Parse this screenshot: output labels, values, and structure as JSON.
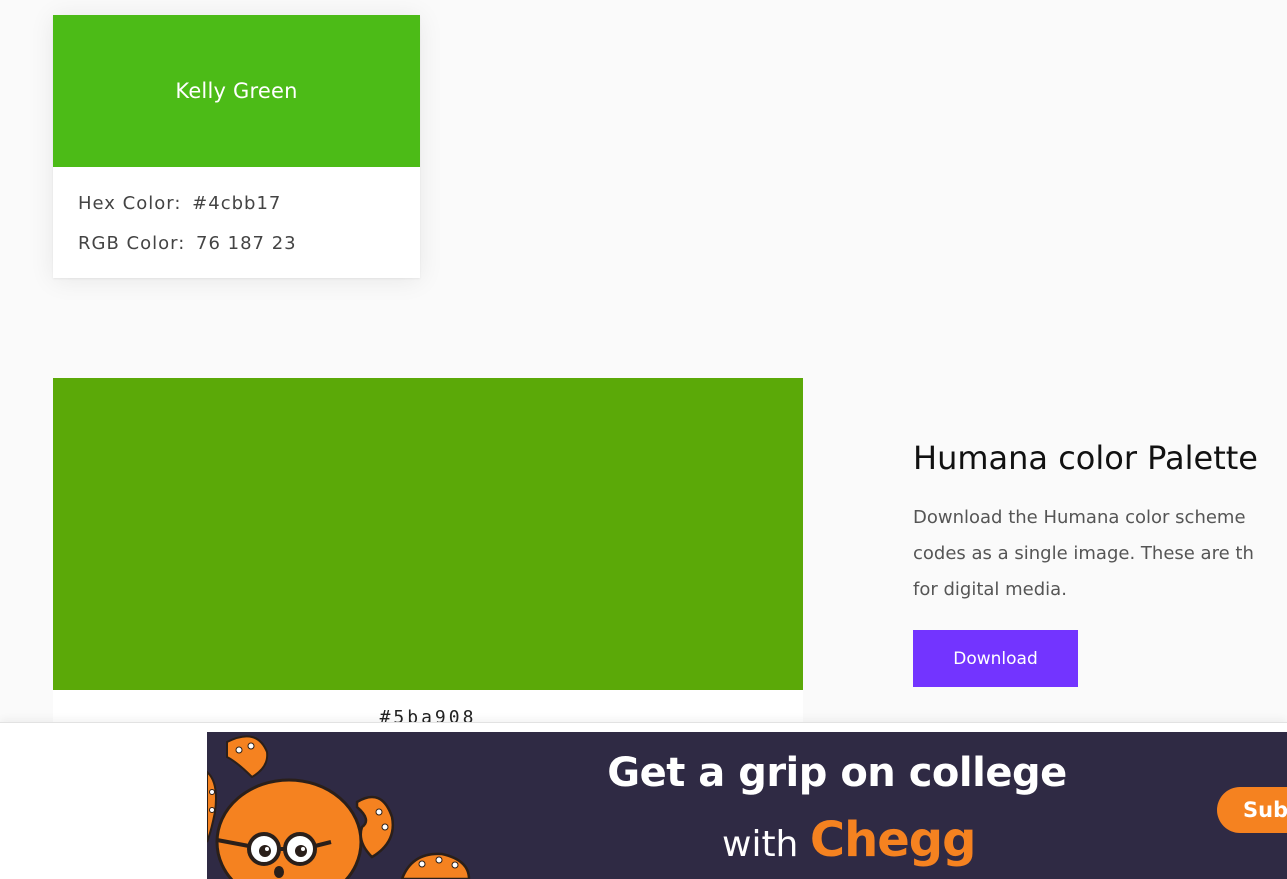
{
  "color_card": {
    "name": "Kelly Green",
    "hex_label": "Hex Color:",
    "hex_value": "#4cbb17",
    "rgb_label": "RGB Color:",
    "rgb_value": "76 187 23",
    "swatch_color": "#4cbb17"
  },
  "palette": {
    "swatch_color": "#5ba908",
    "hex": "#5ba908",
    "title": "Humana color Palette",
    "description_lines": [
      "Download the Humana color scheme",
      "codes as a single image. These are th",
      "for digital media."
    ],
    "download_label": "Download",
    "button_color": "#7334ff"
  },
  "ad": {
    "headline": "Get a grip on college",
    "with_text": "with",
    "brand": "Chegg",
    "cta_label": "Subs",
    "background": "#2f2a44",
    "brand_color": "#f58220"
  }
}
